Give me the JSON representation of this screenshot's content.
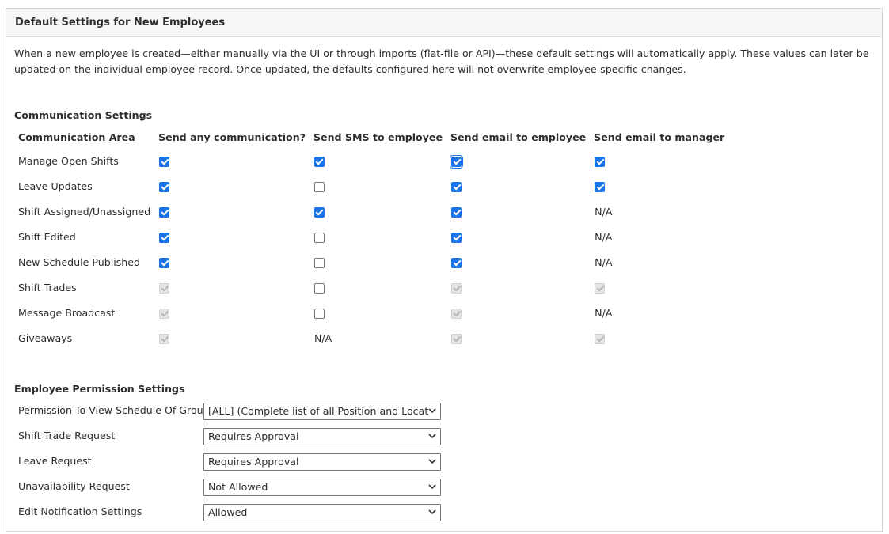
{
  "panel": {
    "title": "Default Settings for New Employees",
    "intro": "When a new employee is created—either manually via the UI or through imports (flat-file or API)—these default settings will automatically apply. These values can later be updated on the individual employee record. Once updated, the defaults configured here will not overwrite employee-specific changes."
  },
  "communication": {
    "title": "Communication Settings",
    "headers": [
      "Communication Area",
      "Send any communication?",
      "Send SMS to employee",
      "Send email to employee",
      "Send email to manager"
    ],
    "rows": [
      {
        "label": "Manage Open Shifts",
        "cells": [
          "checked",
          "checked",
          "checked-focused",
          "checked"
        ]
      },
      {
        "label": "Leave Updates",
        "cells": [
          "checked",
          "unchecked",
          "checked",
          "checked"
        ]
      },
      {
        "label": "Shift Assigned/Unassigned",
        "cells": [
          "checked",
          "checked",
          "checked",
          "N/A"
        ]
      },
      {
        "label": "Shift Edited",
        "cells": [
          "checked",
          "unchecked",
          "checked",
          "N/A"
        ]
      },
      {
        "label": "New Schedule Published",
        "cells": [
          "checked",
          "unchecked",
          "checked",
          "N/A"
        ]
      },
      {
        "label": "Shift Trades",
        "cells": [
          "disabled",
          "unchecked",
          "disabled",
          "disabled"
        ]
      },
      {
        "label": "Message Broadcast",
        "cells": [
          "disabled",
          "unchecked",
          "disabled",
          "N/A"
        ]
      },
      {
        "label": "Giveaways",
        "cells": [
          "disabled",
          "N/A",
          "disabled",
          "disabled"
        ]
      }
    ]
  },
  "permissions": {
    "title": "Employee Permission Settings",
    "rows": [
      {
        "label": "Permission To View Schedule Of Group",
        "value": "[ALL] (Complete list of all Position and Location)"
      },
      {
        "label": "Shift Trade Request",
        "value": "Requires Approval"
      },
      {
        "label": "Leave Request",
        "value": "Requires Approval"
      },
      {
        "label": "Unavailability Request",
        "value": "Not Allowed"
      },
      {
        "label": "Edit Notification Settings",
        "value": "Allowed"
      }
    ]
  },
  "colors": {
    "checkbox_checked": "#1a73e8",
    "header_bg": "#f6f6f6",
    "border": "#d6d6d6"
  },
  "icons": {
    "select_arrow": "chevron-down-icon",
    "checkbox_mark": "checkmark-icon"
  }
}
